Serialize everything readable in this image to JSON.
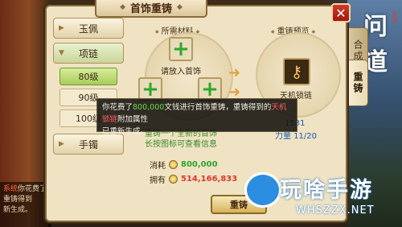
{
  "window": {
    "title": "首饰重铸",
    "close_label": "✕"
  },
  "side_tabs": [
    {
      "label": "合成"
    },
    {
      "label": "重铸"
    }
  ],
  "categories": [
    {
      "label": "玉佩"
    },
    {
      "label": "项链"
    },
    {
      "label": "手镯"
    }
  ],
  "subcategories": [
    {
      "label": "80级"
    },
    {
      "label": "90级"
    },
    {
      "label": "100级"
    }
  ],
  "materials": {
    "header": "所需材料",
    "slot_label": "请放入首饰"
  },
  "preview": {
    "header": "重铸预览",
    "item_name": "天机锁链",
    "stat_partial_1": "1531",
    "stat_label_2": "力量",
    "stat_value_2": "11/20"
  },
  "info_lines": [
    "重铸一个全新的首饰",
    "长按图标可查看信息"
  ],
  "cost": {
    "consume_label": "消耗",
    "consume_value": "800,000",
    "own_label": "拥有",
    "own_value": "514,166,833"
  },
  "reforge_button": "重铸",
  "tooltip": {
    "part1": "你花费了",
    "amount": "800,000",
    "part2": "文钱进行首饰重铸，重铸得到的",
    "item": "天机锁链",
    "part3": "附加属性",
    "line2": "已重新生成。"
  },
  "system_log": {
    "tag": "系统",
    "line1": "你花费了",
    "line2": "重铸得到",
    "line3": "新生成。"
  },
  "watermark": {
    "text": "玩啥手游",
    "url": "WHSZZX.NET"
  },
  "logo": {
    "text": "问道",
    "small": "手游"
  }
}
